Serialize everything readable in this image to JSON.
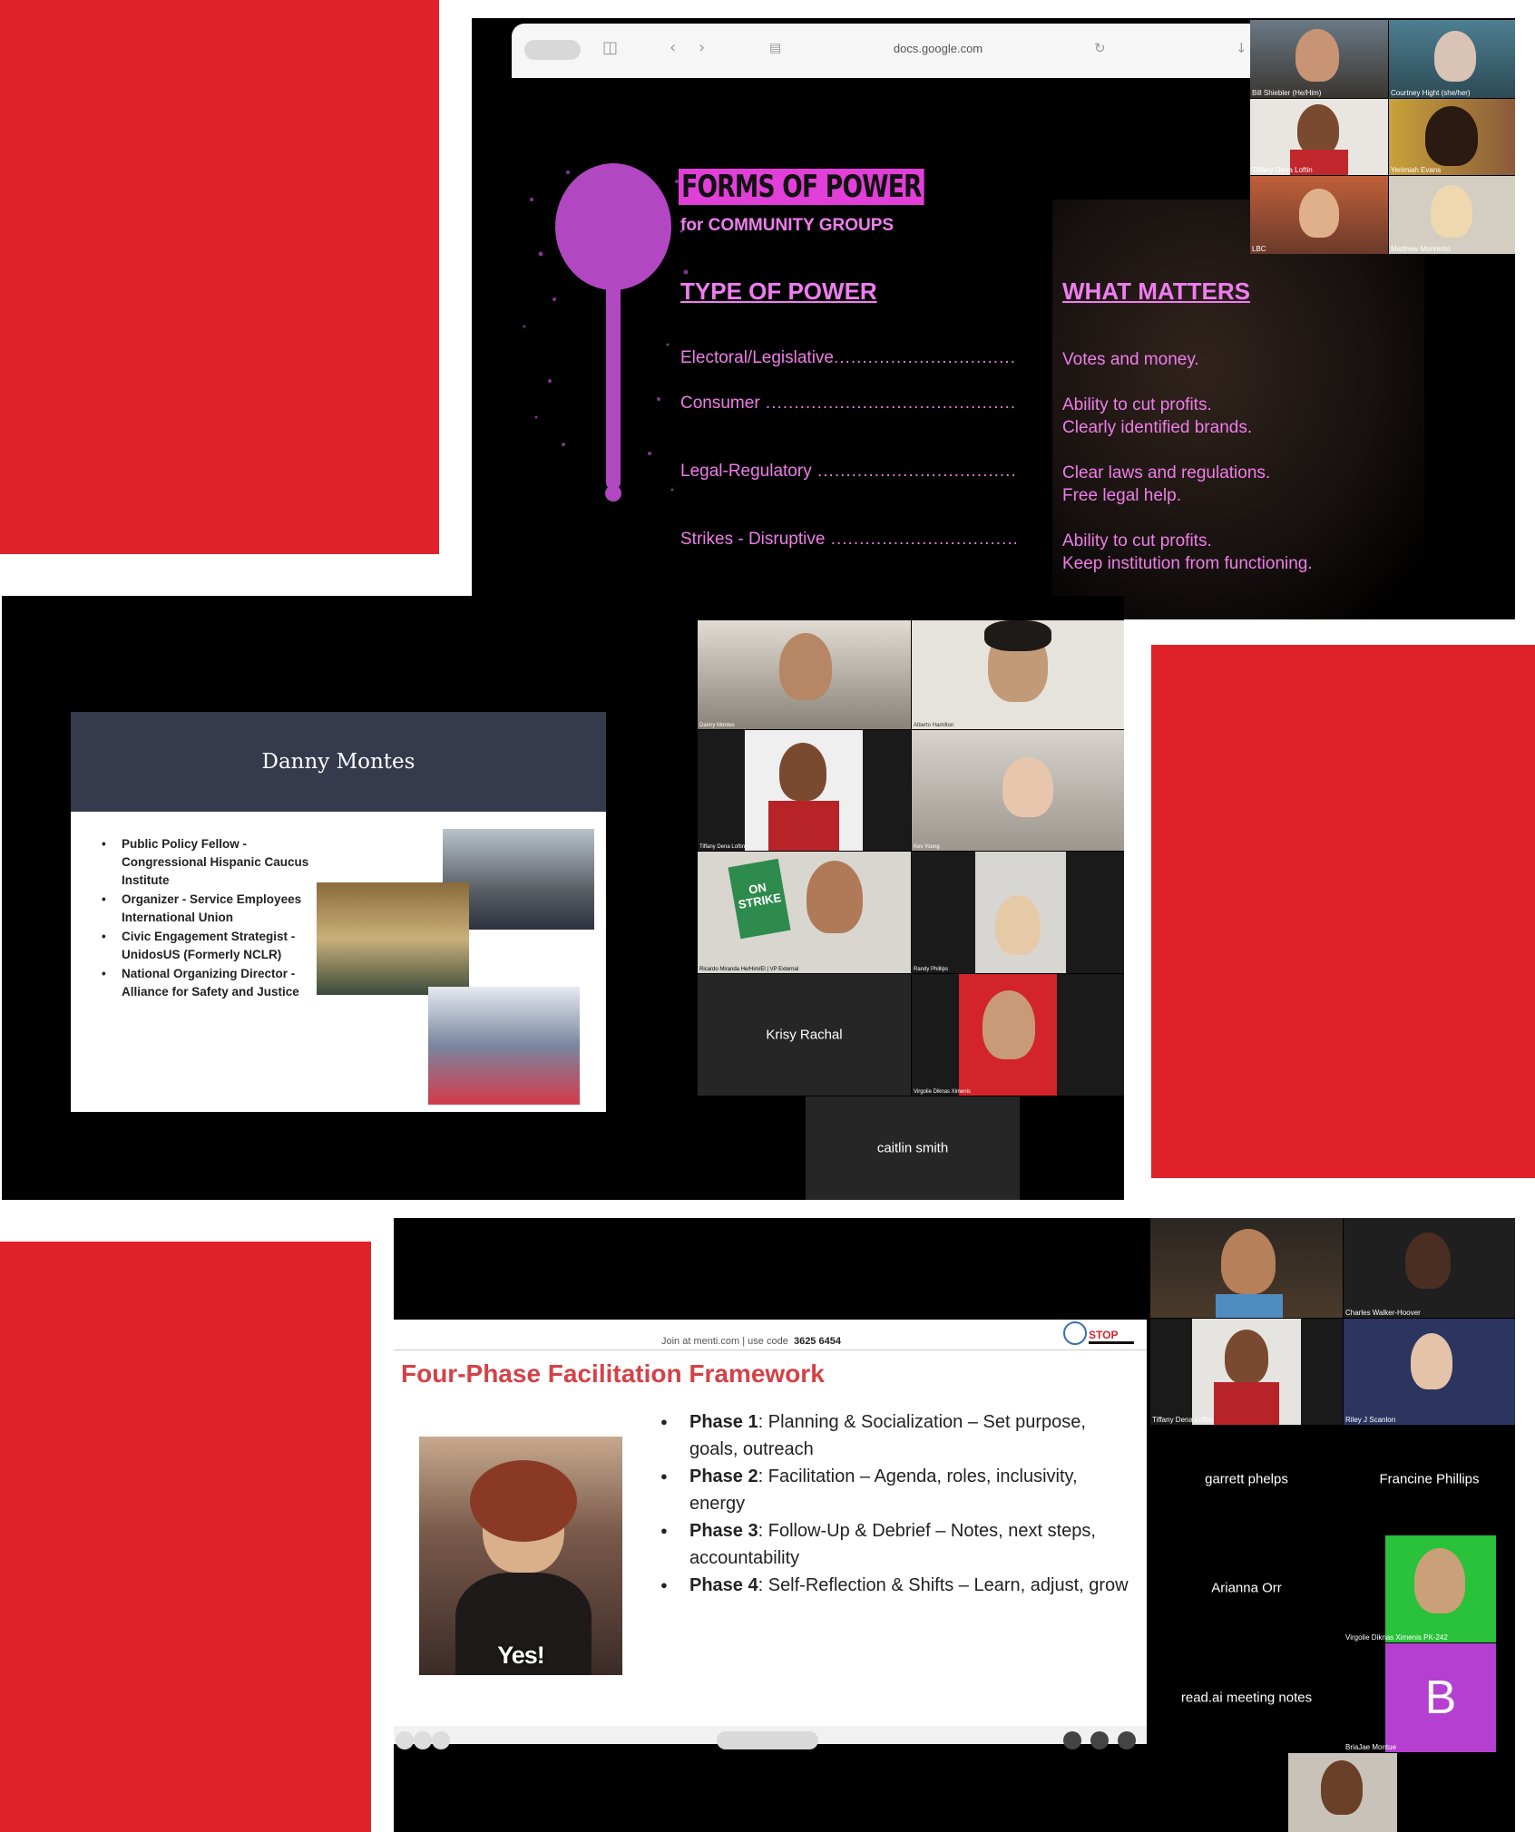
{
  "shot1": {
    "browser": {
      "url": "docs.google.com"
    },
    "slide": {
      "title": "FORMS OF POWER",
      "subtitle": "for COMMUNITY GROUPS",
      "col_left_header": "TYPE OF POWER",
      "col_right_header": "WHAT MATTERS",
      "rows": [
        {
          "type": "Electoral/Legislative",
          "matters_1": "Votes and money.",
          "matters_2": ""
        },
        {
          "type": "Consumer",
          "matters_1": "Ability to cut profits.",
          "matters_2": "Clearly identified brands."
        },
        {
          "type": "Legal-Regulatory",
          "matters_1": "Clear laws and regulations.",
          "matters_2": "Free legal help."
        },
        {
          "type": "Strikes - Disruptive",
          "matters_1": "Ability to cut profits.",
          "matters_2": "Keep institution from functioning."
        }
      ]
    },
    "participants": [
      "Bill Shiebler (He/Him)",
      "Courtney Hight (she/her)",
      "Tiffany Dena Loftin",
      "Yerimiah Evans",
      "LBC",
      "Matthew Morimoto"
    ]
  },
  "shot2": {
    "slide": {
      "name": "Danny Montes",
      "bullets": [
        "Public Policy Fellow - Congressional Hispanic Caucus Institute",
        "Organizer - Service Employees International Union",
        "Civic Engagement Strategist - UnidosUS (Formerly NCLR)",
        "National Organizing Director - Alliance for Safety and Justice"
      ]
    },
    "participants": [
      "Danny Montes",
      "Alberto Hamilton",
      "Tiffany Dena Loftin",
      "Kev Young",
      "Ricardo Miranda He/Him/El | VP External",
      "Randy Phillips",
      "Krisy Rachal",
      "Virgolie Diknas Ximenis",
      "caitlin smith"
    ],
    "sign_text": "ON STRIKE"
  },
  "shot3": {
    "menti": {
      "prefix": "Join at menti.com | use code",
      "code": "3625 6454"
    },
    "logo": "STOP",
    "slide": {
      "title": "Four-Phase Facilitation Framework",
      "phases": [
        {
          "label": "Phase 1",
          "text": ": Planning & Socialization – Set purpose, goals, outreach"
        },
        {
          "label": "Phase 2",
          "text": ": Facilitation – Agenda, roles, inclusivity, energy"
        },
        {
          "label": "Phase 3",
          "text": ": Follow-Up & Debrief – Notes, next steps, accountability"
        },
        {
          "label": "Phase 4",
          "text": ": Self-Reflection & Shifts – Learn, adjust, grow"
        }
      ],
      "gif_caption": "Yes!"
    },
    "participants": [
      "Charles Walker-Hoover",
      "Tiffany Dena Loftin",
      "Riley J Scanlon",
      "garrett phelps",
      "Francine Phillips",
      "Arianna Orr",
      "Virgolie Diknas Ximenis PK-242",
      "read.ai meeting notes",
      "BriaJae Montue"
    ],
    "avatar_letter": "B",
    "colors": {
      "avatar_bg": "#b53fd1",
      "title": "#d54148",
      "accent_red": "#e0232a",
      "slide_pink": "#e13fd8"
    }
  }
}
